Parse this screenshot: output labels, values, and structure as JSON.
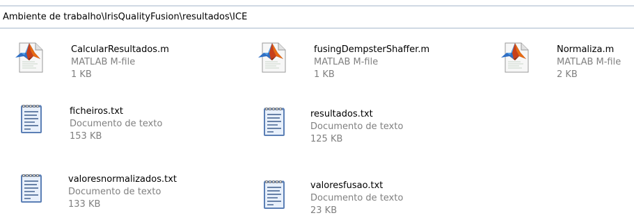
{
  "path": "Ambiente de trabalho\\IrisQualityFusion\\resultados\\ICE",
  "files": [
    {
      "name": "CalcularResultados.m",
      "type": "MATLAB M-file",
      "size": "1 KB",
      "icon": "matlab-file-icon"
    },
    {
      "name": "fusingDempsterShaffer.m",
      "type": "MATLAB M-file",
      "size": "1 KB",
      "icon": "matlab-file-icon"
    },
    {
      "name": "Normaliza.m",
      "type": "MATLAB M-file",
      "size": "2 KB",
      "icon": "matlab-file-icon"
    },
    {
      "name": "ficheiros.txt",
      "type": "Documento de texto",
      "size": "153 KB",
      "icon": "text-file-icon"
    },
    {
      "name": "resultados.txt",
      "type": "Documento de texto",
      "size": "125 KB",
      "icon": "text-file-icon"
    },
    {
      "name": "valoresnormalizados.txt",
      "type": "Documento de texto",
      "size": "133 KB",
      "icon": "text-file-icon"
    },
    {
      "name": "valoresfusao.txt",
      "type": "Documento de texto",
      "size": "23 KB",
      "icon": "text-file-icon"
    }
  ]
}
